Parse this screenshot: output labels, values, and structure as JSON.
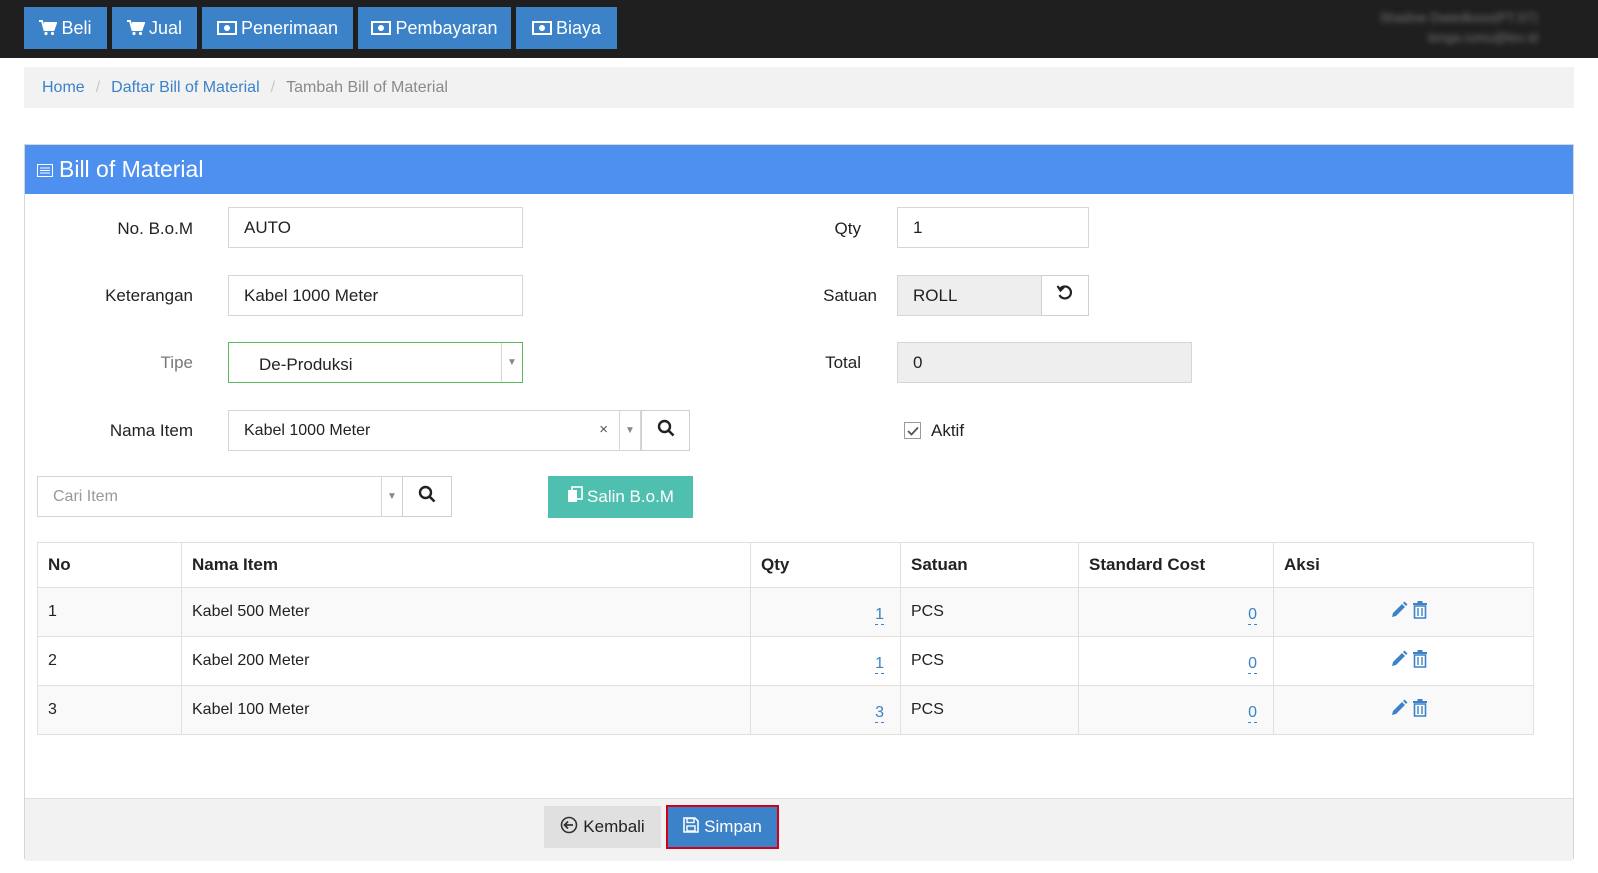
{
  "nav": {
    "buttons": [
      {
        "label": "Beli",
        "icon": "cart-icon"
      },
      {
        "label": "Jual",
        "icon": "cart-icon"
      },
      {
        "label": "Penerimaan",
        "icon": "money-icon"
      },
      {
        "label": "Pembayaran",
        "icon": "money-icon"
      },
      {
        "label": "Biaya",
        "icon": "money-icon"
      }
    ],
    "user_line1": "Shadow Dwiedkoso(PT.ST)",
    "user_line2": "tenga.rumu@leo.id"
  },
  "breadcrumb": {
    "home": "Home",
    "list": "Daftar Bill of Material",
    "current": "Tambah Bill of Material",
    "separator": "/"
  },
  "panel": {
    "title": "Bill of Material"
  },
  "form": {
    "no_bom_label": "No. B.o.M",
    "no_bom_value": "AUTO",
    "keterangan_label": "Keterangan",
    "keterangan_value": "Kabel 1000 Meter",
    "tipe_label": "Tipe",
    "tipe_value": "De-Produksi",
    "nama_item_label": "Nama Item",
    "nama_item_value": "Kabel 1000 Meter",
    "clear_glyph": "×",
    "qty_label": "Qty",
    "qty_value": "1",
    "satuan_label": "Satuan",
    "satuan_value": "ROLL",
    "total_label": "Total",
    "total_value": "0",
    "aktif_label": "Aktif",
    "aktif_checked": true,
    "cari_item_placeholder": "Cari Item",
    "salin_label": "Salin B.o.M"
  },
  "table": {
    "headers": [
      "No",
      "Nama Item",
      "Qty",
      "Satuan",
      "Standard Cost",
      "Aksi"
    ],
    "rows": [
      {
        "no": "1",
        "nama": "Kabel 500 Meter",
        "qty": "1",
        "satuan": "PCS",
        "cost": "0"
      },
      {
        "no": "2",
        "nama": "Kabel 200 Meter",
        "qty": "1",
        "satuan": "PCS",
        "cost": "0"
      },
      {
        "no": "3",
        "nama": "Kabel 100 Meter",
        "qty": "3",
        "satuan": "PCS",
        "cost": "0"
      }
    ]
  },
  "footer": {
    "kembali_label": "Kembali",
    "simpan_label": "Simpan"
  },
  "colors": {
    "primary": "#3b82c8",
    "panel_header": "#4d90f0",
    "teal": "#4fbfaf",
    "highlight": "#d0021b"
  }
}
